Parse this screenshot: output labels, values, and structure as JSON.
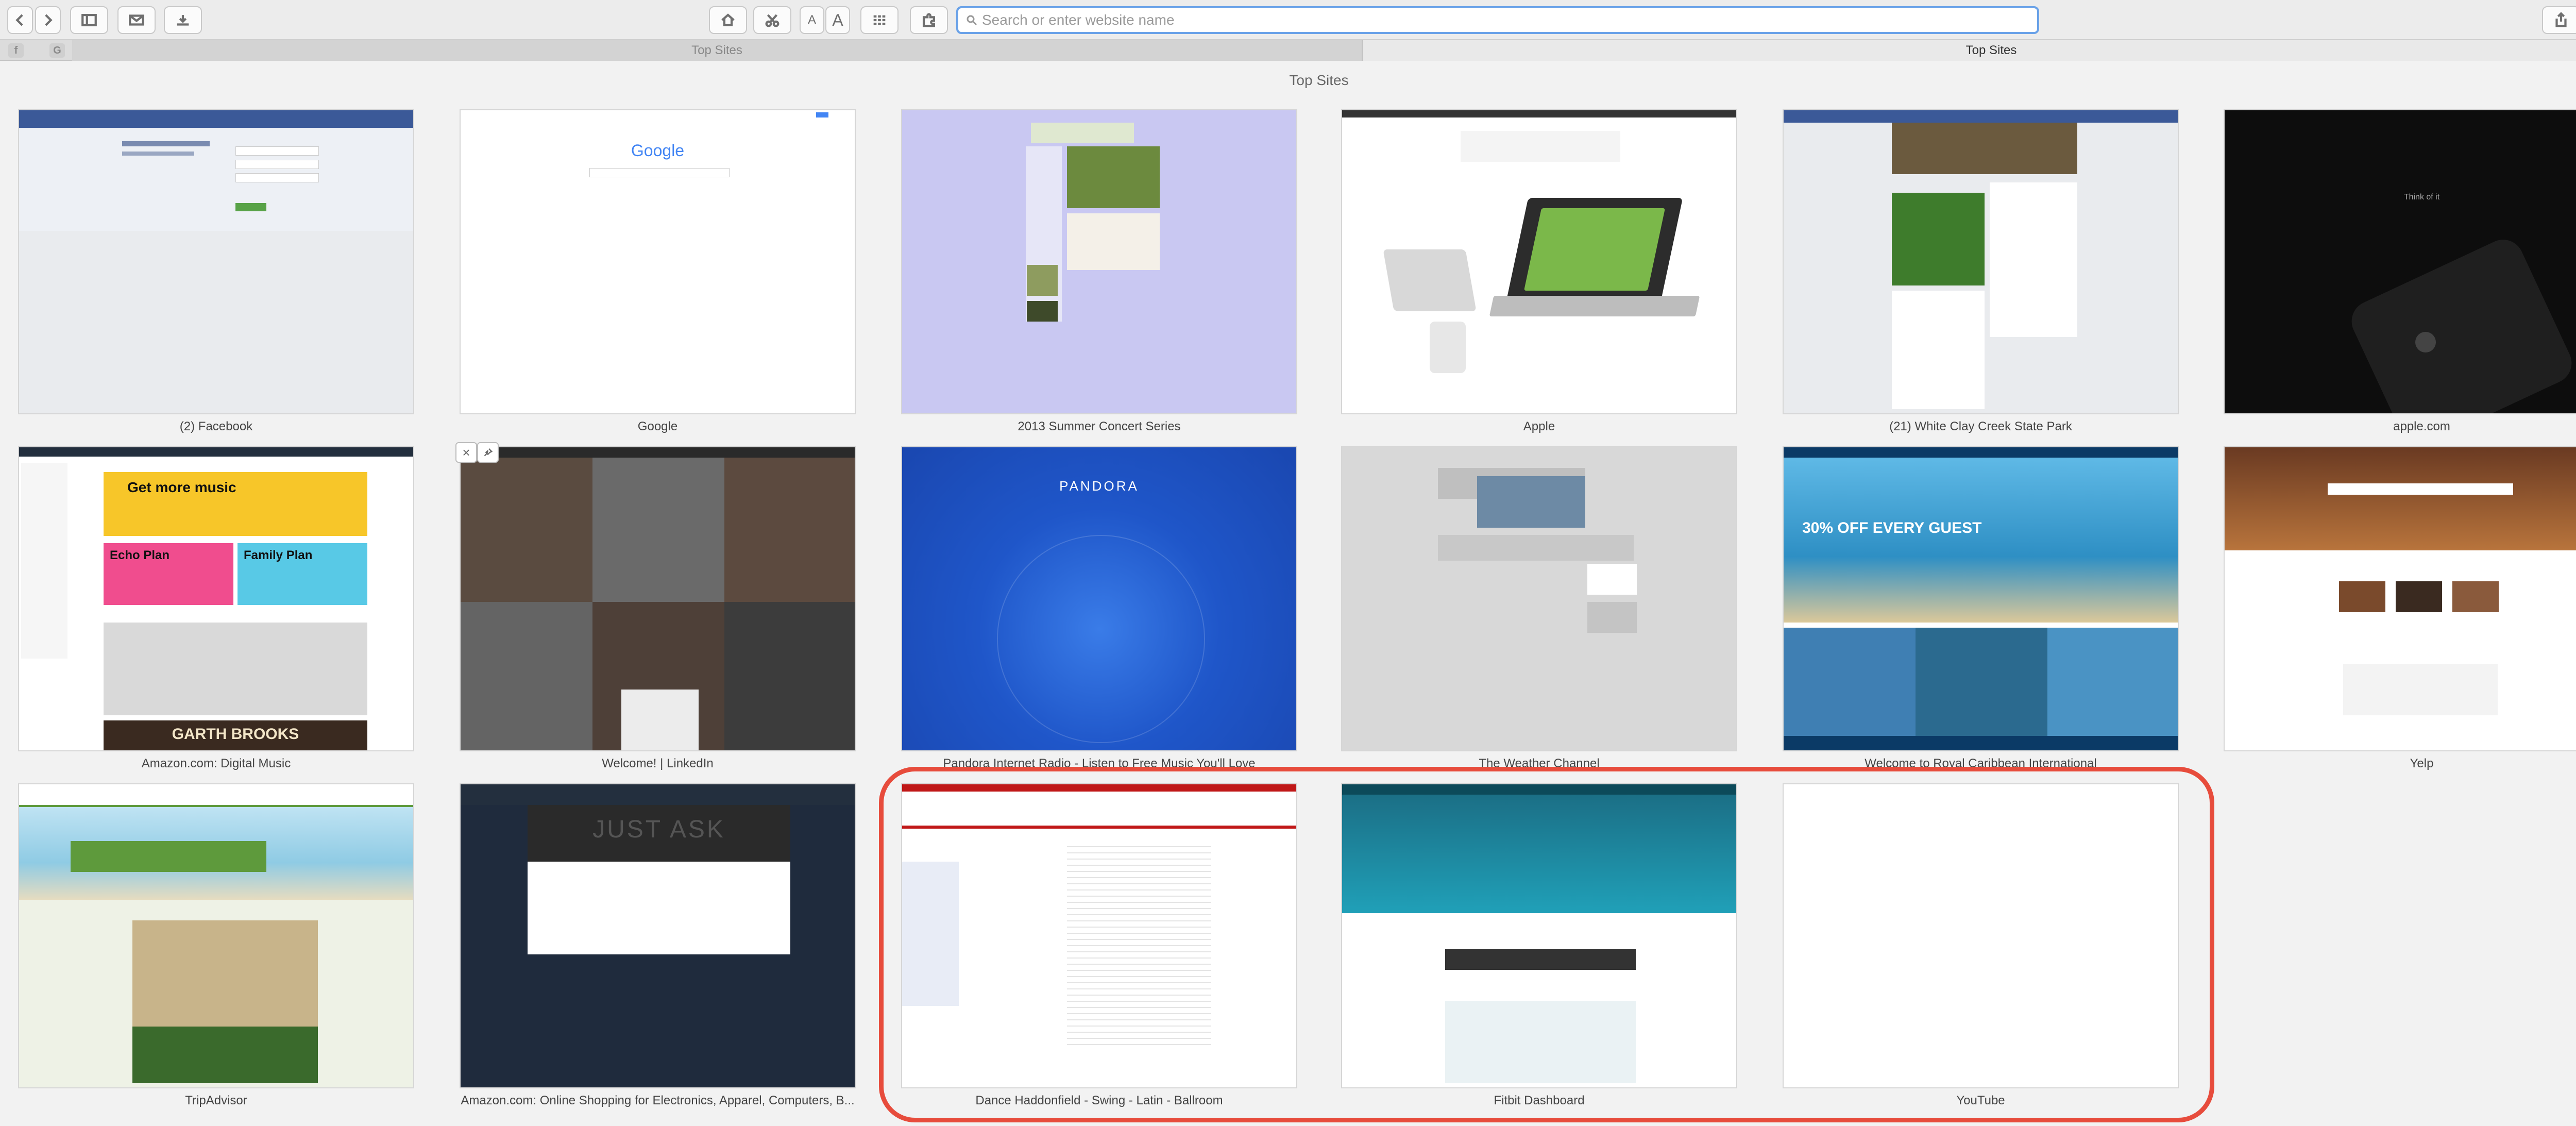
{
  "toolbar": {
    "back_icon": "chevron-left-icon",
    "forward_icon": "chevron-right-icon",
    "sidebar_icon": "sidebar-icon",
    "mail_icon": "mail-icon",
    "share_icon": "download-icon",
    "home_icon": "home-icon",
    "bookmark_icon": "scissors-icon",
    "font_small": "A",
    "font_large": "A",
    "grid_icon": "grid-icon",
    "puzzle_icon": "extension-icon",
    "address_placeholder": "Search or enter website name",
    "share_right_icon": "share-icon",
    "tabs_icon": "tabs-icon"
  },
  "tabs": [
    {
      "label": "Top Sites"
    },
    {
      "label": "Top Sites"
    }
  ],
  "tab_plus": "+",
  "page_heading": "Top Sites",
  "sites": [
    {
      "label": "(2) Facebook",
      "accent": "#3b5998"
    },
    {
      "label": "Google",
      "accent": "#4285f4"
    },
    {
      "label": "2013 Summer Concert Series",
      "accent": "#c9c8f2"
    },
    {
      "label": "Apple",
      "accent": "#777777"
    },
    {
      "label": "(21) White Clay Creek State Park",
      "accent": "#3b5998"
    },
    {
      "label": "apple.com",
      "accent": "#111111"
    },
    {
      "label": "Amazon.com: Digital Music",
      "accent": "#f4c22a"
    },
    {
      "label": "Welcome! | LinkedIn",
      "accent": "#5a5a5a"
    },
    {
      "label": "Pandora Internet Radio - Listen to Free Music You'll Love",
      "accent": "#1e56c8"
    },
    {
      "label": "The Weather Channel",
      "accent": "#dcdcdc"
    },
    {
      "label": "Welcome to Royal Caribbean International",
      "accent": "#1793c5"
    },
    {
      "label": "Yelp",
      "accent": "#b33b2a"
    },
    {
      "label": "TripAdvisor",
      "accent": "#5e9a3c"
    },
    {
      "label": "Amazon.com: Online Shopping for Electronics, Apparel, Computers, B...",
      "accent": "#1f2b3d"
    },
    {
      "label": "Dance Haddonfield - Swing - Latin - Ballroom",
      "accent": "#c01818"
    },
    {
      "label": "Fitbit Dashboard",
      "accent": "#1b6f86"
    },
    {
      "label": "YouTube",
      "accent": "#ffffff"
    }
  ],
  "thumb_text": {
    "google_logo": "Google",
    "pandora_logo": "PANDORA",
    "amazon_music_banner": "Get more music",
    "echo_plan": "Echo Plan",
    "family_plan": "Family Plan",
    "garth": "GARTH BROOKS",
    "just_ask": "JUST ASK",
    "royal_offer": "30% OFF EVERY GUEST",
    "apple_tagline": "Think of it"
  },
  "hover_controls": {
    "close": "×",
    "pin_icon": "pin-icon"
  }
}
